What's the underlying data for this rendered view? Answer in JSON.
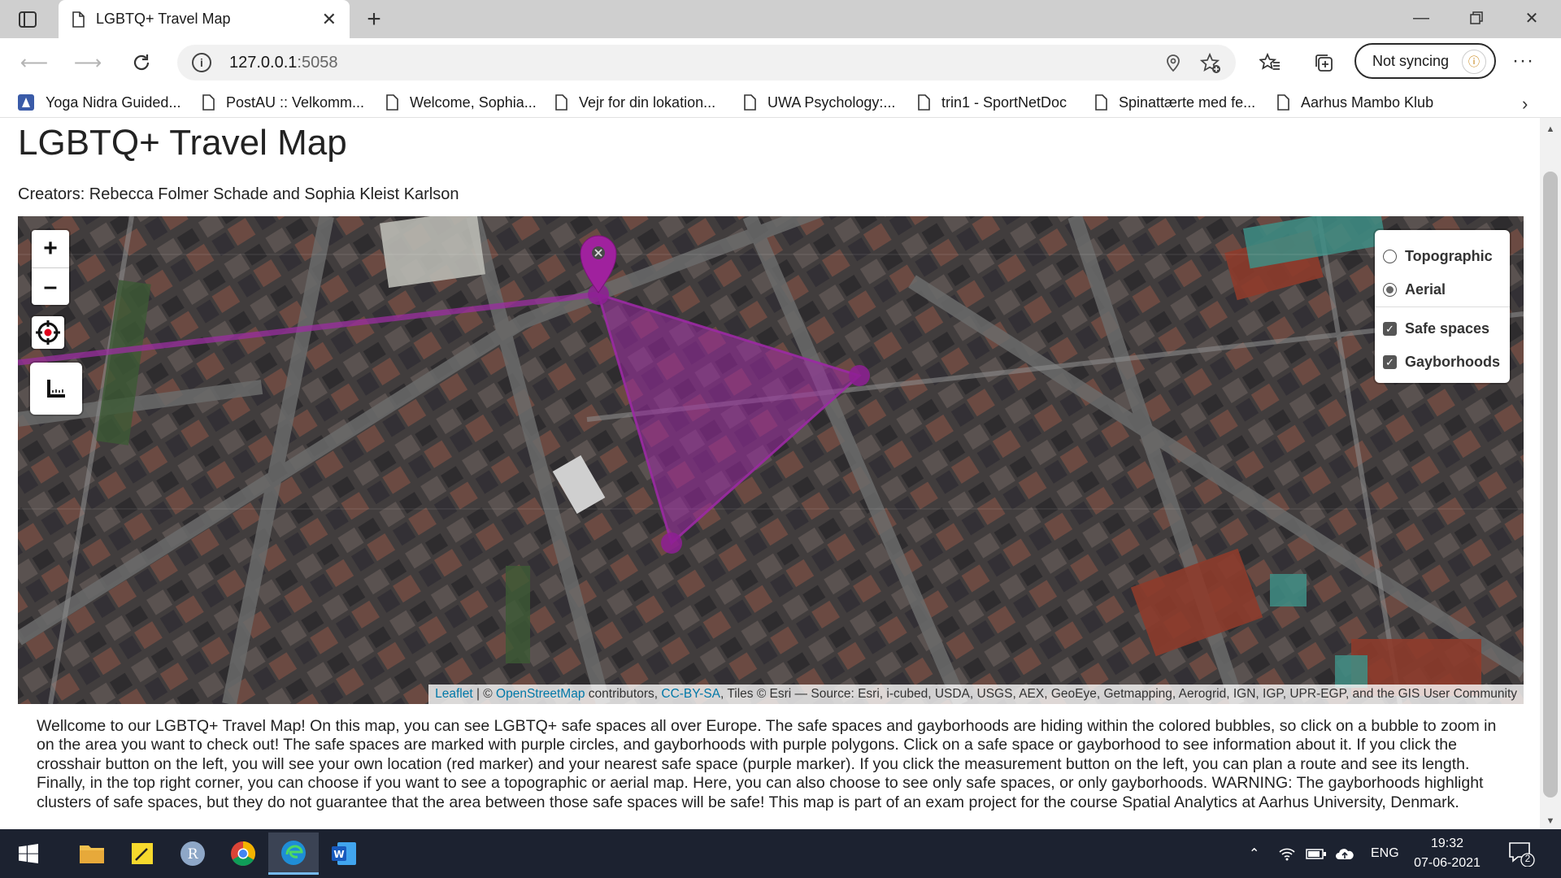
{
  "browser": {
    "tab_title": "LGBTQ+ Travel Map",
    "url_host": "127.0.0.1",
    "url_port": ":5058",
    "sync_label": "Not syncing",
    "favorites": [
      "Yoga Nidra Guided...",
      "PostAU :: Velkomm...",
      "Welcome, Sophia...",
      "Vejr for din lokation...",
      "UWA Psychology:...",
      "trin1 - SportNetDoc",
      "Spinattærte med fe...",
      "Aarhus Mambo Klub"
    ]
  },
  "page": {
    "title": "LGBTQ+ Travel Map",
    "creators": "Creators: Rebecca Folmer Schade and Sophia Kleist Karlson",
    "intro": "Wellcome to our LGBTQ+ Travel Map! On this map, you can see LGBTQ+ safe spaces all over Europe. The safe spaces and gayborhoods are hiding within the colored bubbles, so click on a bubble to zoom in on the area you want to check out! The safe spaces are marked with purple circles, and gayborhoods with purple polygons. Click on a safe space or gayborhood to see information about it. If you click the crosshair button on the left, you will see your own location (red marker) and your nearest safe space (purple marker). If you click the measurement button on the left, you can plan a route and see its length. Finally, in the top right corner, you can choose if you want to see a topographic or aerial map. Here, you can also choose to see only safe spaces, or only gayborhoods. WARNING: The gayborhoods highlight clusters of safe spaces, but they do not guarantee that the area between those safe spaces will be safe! This map is part of an exam project for the course Spatial Analytics at Aarhus University, Denmark."
  },
  "map": {
    "zoom_in": "+",
    "zoom_out": "–",
    "layers": {
      "base": [
        {
          "label": "Topographic",
          "selected": false
        },
        {
          "label": "Aerial",
          "selected": true
        }
      ],
      "overlays": [
        {
          "label": "Safe spaces",
          "checked": true
        },
        {
          "label": "Gayborhoods",
          "checked": true
        }
      ]
    },
    "attribution": {
      "leaflet": "Leaflet",
      "sep": " | © ",
      "osm": "OpenStreetMap",
      "contributors": " contributors, ",
      "license": "CC-BY-SA",
      "tiles": ", Tiles © Esri — Source: Esri, i-cubed, USDA, USGS, AEX, GeoEye, Getmapping, Aerogrid, IGN, IGP, UPR-EGP, and the GIS User Community"
    },
    "colors": {
      "gayborhood": "#8e1f94",
      "marker": "#a0219e"
    }
  },
  "taskbar": {
    "lang": "ENG",
    "time": "19:32",
    "date": "07-06-2021",
    "notification_count": "2"
  }
}
